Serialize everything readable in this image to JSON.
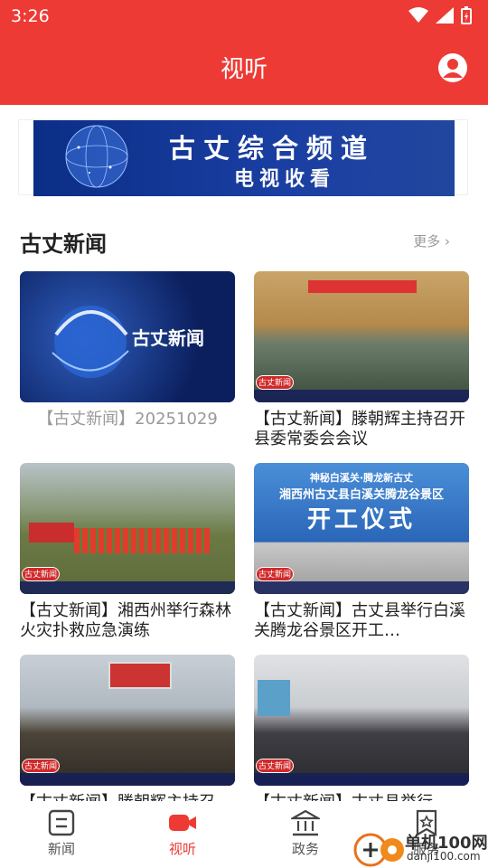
{
  "status": {
    "time": "3:26"
  },
  "header": {
    "title": "视听"
  },
  "banner": {
    "title": "古丈综合频道",
    "subtitle": "电视收看"
  },
  "section": {
    "title": "古丈新闻",
    "more": "更多"
  },
  "cards": [
    {
      "caption": "【古丈新闻】20251029",
      "thumb_text": "古丈新闻"
    },
    {
      "caption": "【古丈新闻】滕朝辉主持召开县委常委会会议",
      "badge": "古丈新闻"
    },
    {
      "caption": "【古丈新闻】湘西州举行森林火灾扑救应急演练",
      "badge": "古丈新闻"
    },
    {
      "caption": "【古丈新闻】古丈县举行白溪关腾龙谷景区开工…",
      "badge": "古丈新闻",
      "sign1": "神秘白溪关·腾龙新古丈",
      "sign2": "湘西州古丈县白溪关腾龙谷景区",
      "sign3": "开工仪式"
    },
    {
      "caption": "【古丈新闻】滕朝辉主持召",
      "badge": "古丈新闻"
    },
    {
      "caption": "【古丈新闻】古丈县举行",
      "badge": "古丈新闻"
    }
  ],
  "tabs": [
    {
      "label": "新闻"
    },
    {
      "label": "视听"
    },
    {
      "label": "政务"
    },
    {
      "label": "服务"
    }
  ],
  "watermark": {
    "main": "单机100网",
    "sub": "danji100.com"
  },
  "colors": {
    "accent": "#ee3a35",
    "banner_bg": "#1a3fa3"
  }
}
